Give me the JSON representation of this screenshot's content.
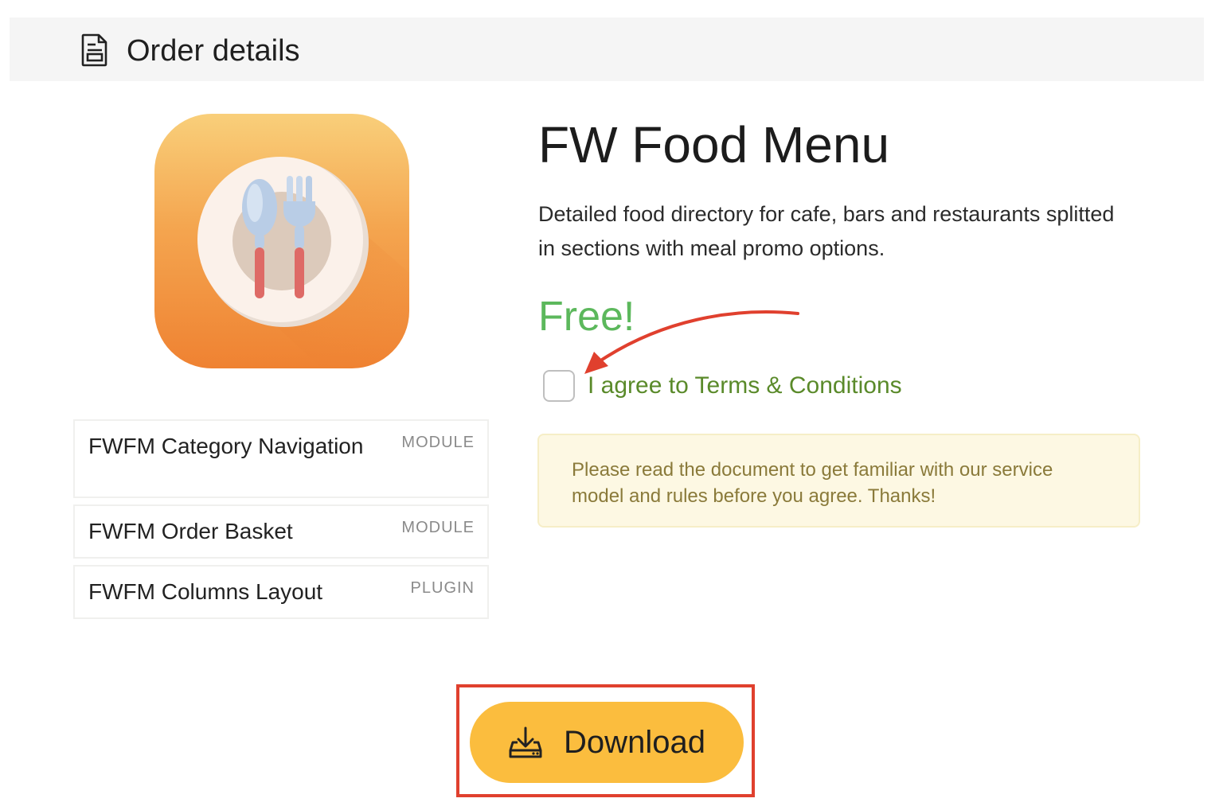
{
  "header": {
    "title": "Order details",
    "icon": "document-icon"
  },
  "product": {
    "title": "FW Food Menu",
    "description": "Detailed food directory for cafe, bars and restaurants splitted in sections with meal promo options.",
    "price": "Free!",
    "icon": "plate-cutlery-icon",
    "price_color": "#5cb85c"
  },
  "components": [
    {
      "name": "FWFM Category Navigation",
      "type": "MODULE"
    },
    {
      "name": "FWFM Order Basket",
      "type": "MODULE"
    },
    {
      "name": "FWFM Columns Layout",
      "type": "PLUGIN"
    }
  ],
  "terms": {
    "label": "I agree to Terms & Conditions",
    "checked": false
  },
  "notice": {
    "text": "Please read the document to get familiar with our service model and rules before you agree. Thanks!"
  },
  "download": {
    "label": "Download",
    "icon": "download-tray-icon",
    "color": "#fbbd3e"
  },
  "annotations": {
    "highlight_color": "#e0402e"
  }
}
